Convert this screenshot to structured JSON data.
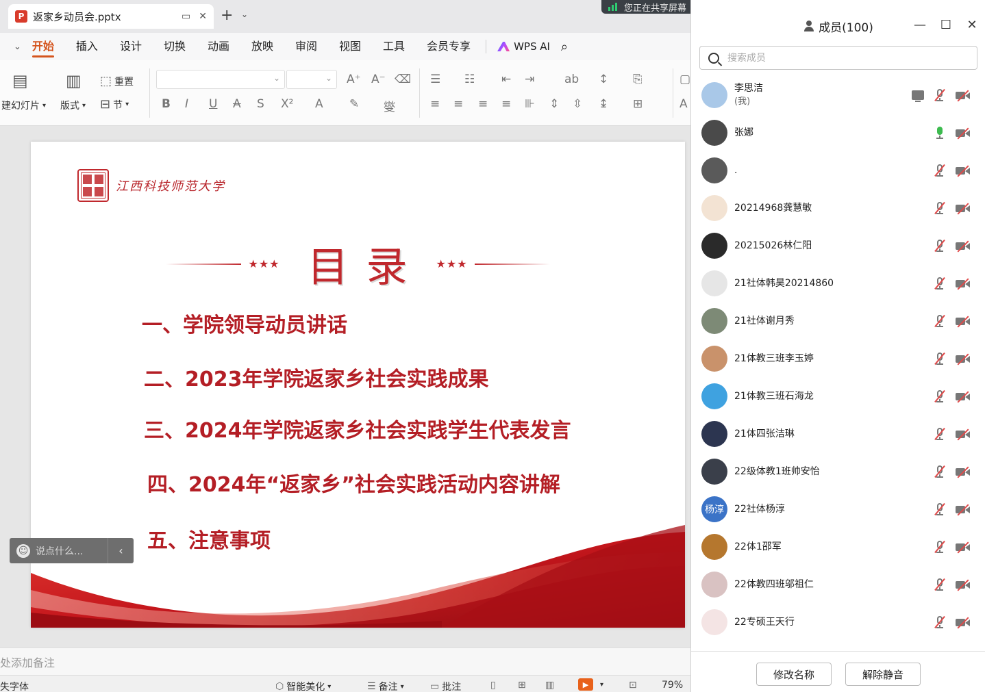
{
  "app": {
    "doc_tab_title": "返家乡动员会.pptx",
    "share_banner": "您正在共享屏幕"
  },
  "menu": {
    "items": [
      "开始",
      "插入",
      "设计",
      "切换",
      "动画",
      "放映",
      "审阅",
      "视图",
      "工具",
      "会员专享"
    ],
    "active": "开始",
    "wps_ai": "WPS AI"
  },
  "ribbon": {
    "new_slide": "建幻灯片",
    "layout": "版式",
    "reset": "重置",
    "section": "节"
  },
  "slide": {
    "university": "江西科技师范大学",
    "title": "目录",
    "stars": "★★★",
    "toc": [
      "一、学院领导动员讲话",
      "二、2023年学院返家乡社会实践成果",
      "三、2024年学院返家乡社会实践学生代表发言",
      "四、2024年“返家乡”社会实践活动内容讲解",
      "五、注意事项"
    ]
  },
  "comment": {
    "placeholder": "说点什么..."
  },
  "notes": {
    "placeholder": "处添加备注"
  },
  "status": {
    "font_missing": "失字体",
    "smart_beautify": "智能美化",
    "notes": "备注",
    "comment": "批注",
    "zoom": "79%"
  },
  "panel": {
    "title": "成员(100)",
    "search_placeholder": "搜索成员",
    "members": [
      {
        "name": "李思洁",
        "sub": "(我)",
        "mic": "muted",
        "sharing": true,
        "avatar_color": "#a9c8e8"
      },
      {
        "name": "张娜",
        "mic": "on",
        "avatar_color": "#4a4a4a"
      },
      {
        "name": ".",
        "mic": "muted",
        "avatar_color": "#5a5a5a"
      },
      {
        "name": "20214968龚慧敏",
        "mic": "muted",
        "avatar_color": "#f3e3d3"
      },
      {
        "name": "20215026林仁阳",
        "mic": "muted",
        "avatar_color": "#2a2a2a"
      },
      {
        "name": "21社体韩昊20214860",
        "mic": "muted",
        "avatar_color": "#e6e6e6"
      },
      {
        "name": "21社体谢月秀",
        "mic": "muted",
        "avatar_color": "#7d8a76"
      },
      {
        "name": "21体教三班李玉婷",
        "mic": "muted",
        "avatar_color": "#c9926b"
      },
      {
        "name": "21体教三班石海龙",
        "mic": "muted",
        "avatar_color": "#3fa2e0"
      },
      {
        "name": "21体四张洁琳",
        "mic": "muted",
        "avatar_color": "#2c3550"
      },
      {
        "name": "22级体教1班帅安怡",
        "mic": "muted",
        "avatar_color": "#3a3f4a"
      },
      {
        "name": "22社体杨淳",
        "mic": "muted",
        "avatar_color": "#3b73c7",
        "avatar_text": "杨淳"
      },
      {
        "name": "22体1邵军",
        "mic": "muted",
        "avatar_color": "#b5772e"
      },
      {
        "name": "22体教四班邬祖仁",
        "mic": "muted",
        "avatar_color": "#d9c2c2"
      },
      {
        "name": "22专硕王天行",
        "mic": "muted",
        "avatar_color": "#f4e4e4"
      }
    ],
    "rename_button": "修改名称",
    "unmute_button": "解除静音"
  }
}
